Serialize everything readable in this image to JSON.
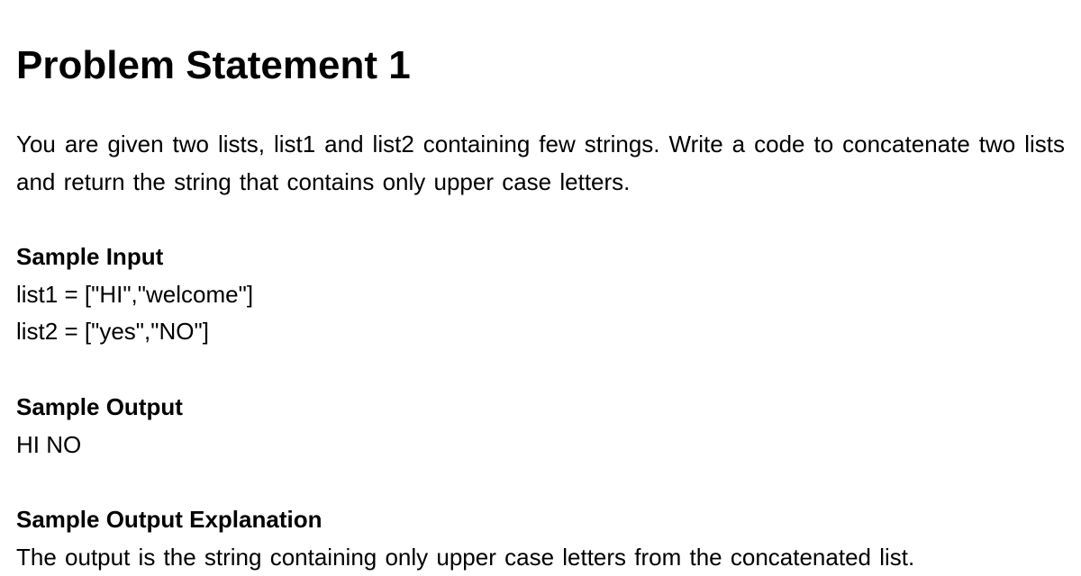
{
  "title": "Problem Statement 1",
  "description": "You are given two lists, list1 and list2 containing few strings. Write a code to concatenate two lists and return the string that contains only upper case letters.",
  "sample_input": {
    "heading": "Sample Input",
    "line1": "list1 = [\"HI\",\"welcome\"]",
    "line2": "list2 = [\"yes\",\"NO\"]"
  },
  "sample_output": {
    "heading": "Sample Output",
    "value": "HI NO"
  },
  "sample_output_explanation": {
    "heading": "Sample Output Explanation",
    "text": "The output is the string containing only upper case letters from the concatenated list."
  }
}
